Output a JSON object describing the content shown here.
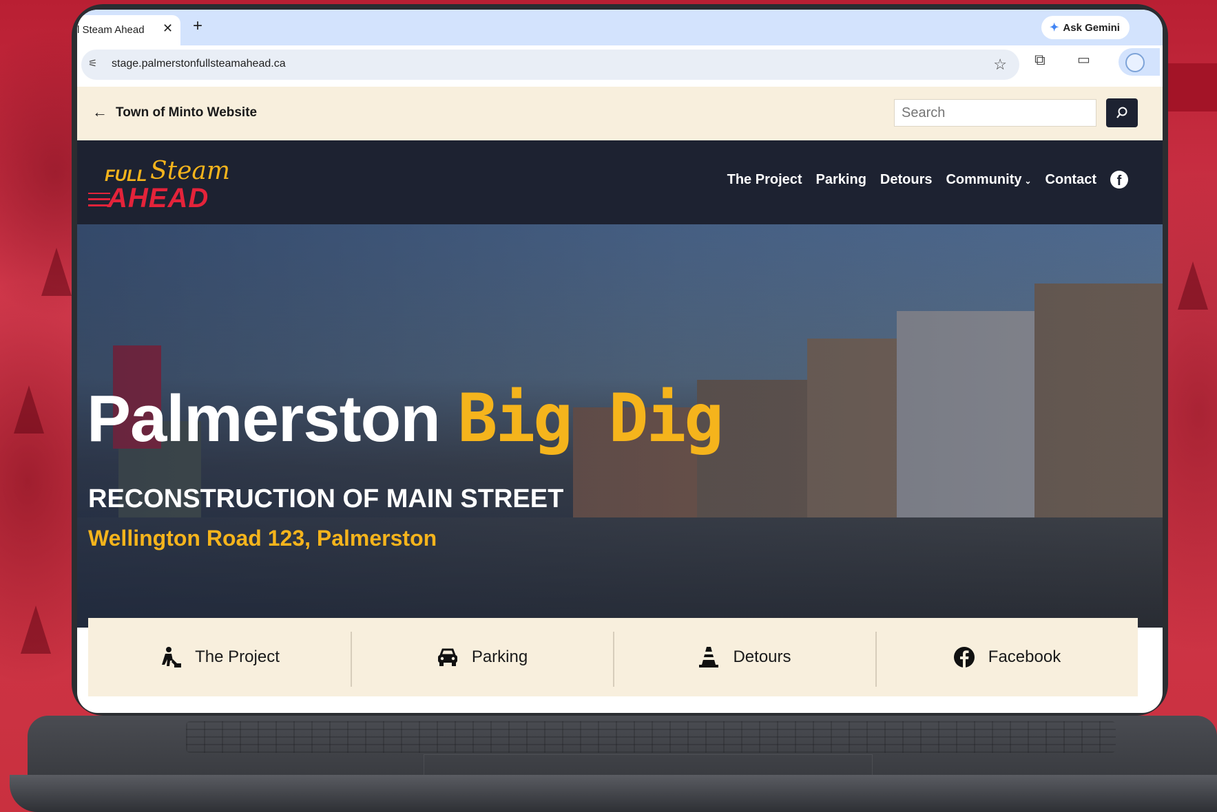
{
  "browser": {
    "tab_title": "l Steam Ahead",
    "new_tab": "+",
    "close": "✕",
    "ask_gemini": "Ask Gemini",
    "url": "stage.palmerstonfullsteamahead.ca"
  },
  "topbar": {
    "back_label": "Town of Minto Website",
    "search_placeholder": "Search"
  },
  "logo": {
    "full": "FULL",
    "steam": "Steam",
    "ahead": "AHEAD"
  },
  "nav": {
    "items": [
      "The Project",
      "Parking",
      "Detours",
      "Community",
      "Contact"
    ],
    "community_chevron": "⌄"
  },
  "hero": {
    "title_main": "Palmerston",
    "title_accent": "Big Dig",
    "subtitle": "RECONSTRUCTION OF MAIN STREET",
    "address": "Wellington Road 123, Palmerston"
  },
  "quicklinks": [
    {
      "label": "The Project",
      "icon": "worker-icon"
    },
    {
      "label": "Parking",
      "icon": "car-icon"
    },
    {
      "label": "Detours",
      "icon": "traffic-cone-icon"
    },
    {
      "label": "Facebook",
      "icon": "facebook-icon"
    }
  ],
  "colors": {
    "accent_yellow": "#f5b41c",
    "brand_red": "#e4233a",
    "navy": "#1d2231",
    "cream": "#f8efdd"
  }
}
